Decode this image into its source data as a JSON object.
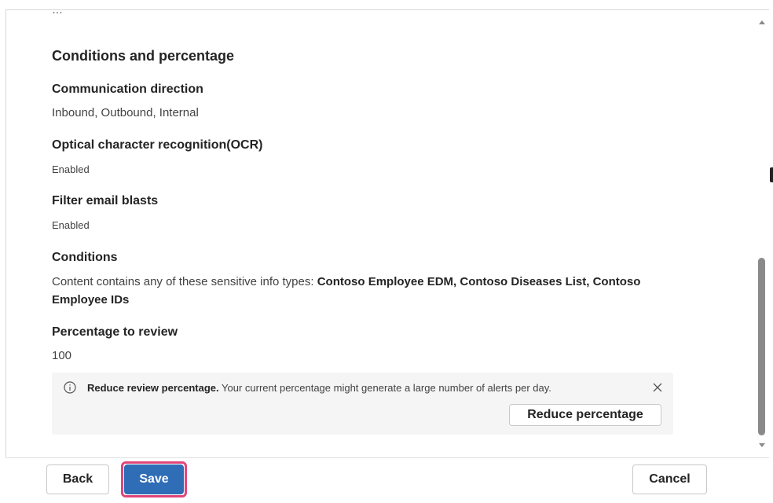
{
  "partial_top_text": "…",
  "section_title": "Conditions and percentage",
  "fields": {
    "communication": {
      "label": "Communication direction",
      "value": "Inbound, Outbound, Internal"
    },
    "ocr": {
      "label": "Optical character recognition(OCR)",
      "value": "Enabled"
    },
    "email_blasts": {
      "label": "Filter email blasts",
      "value": "Enabled"
    },
    "conditions": {
      "label": "Conditions",
      "prefix": "Content contains any of these sensitive info types: ",
      "types": "Contoso Employee EDM, Contoso Diseases List, Contoso Employee IDs"
    },
    "percentage": {
      "label": "Percentage to review",
      "value": "100"
    }
  },
  "notice": {
    "title": "Reduce review percentage.",
    "message": " Your current percentage might generate a large number of alerts per day.",
    "action_label": "Reduce percentage",
    "icon": "info-icon",
    "close_icon": "close-icon"
  },
  "footer": {
    "back_label": "Back",
    "save_label": "Save",
    "cancel_label": "Cancel"
  },
  "colors": {
    "primary": "#2f6db6",
    "highlight": "#e0457b",
    "notice_bg": "#f5f5f5"
  }
}
